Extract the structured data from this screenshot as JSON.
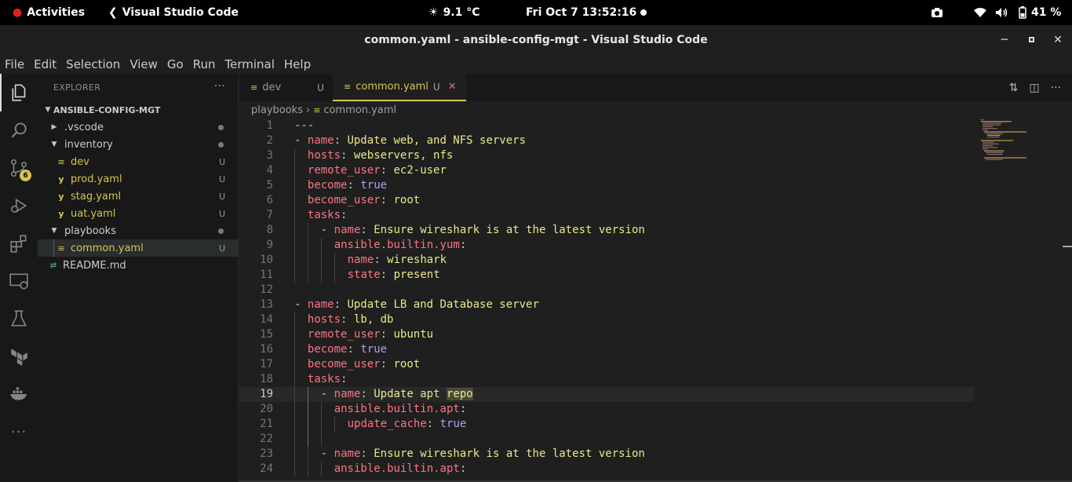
{
  "topbar": {
    "activities": "Activities",
    "app_name": "Visual Studio Code",
    "weather": "9.1 °C",
    "datetime": "Fri Oct 7  13:52:16",
    "battery": "41 %"
  },
  "window": {
    "title": "common.yaml - ansible-config-mgt - Visual Studio Code"
  },
  "menu": [
    "File",
    "Edit",
    "Selection",
    "View",
    "Go",
    "Run",
    "Terminal",
    "Help"
  ],
  "activity": {
    "scm_badge": "6"
  },
  "explorer": {
    "header": "EXPLORER",
    "root": "ANSIBLE-CONFIG-MGT",
    "items": [
      {
        "label": ".vscode",
        "deco": ""
      },
      {
        "label": "inventory",
        "deco": ""
      },
      {
        "label": "dev",
        "deco": "U"
      },
      {
        "label": "prod.yaml",
        "deco": "U"
      },
      {
        "label": "stag.yaml",
        "deco": "U"
      },
      {
        "label": "uat.yaml",
        "deco": "U"
      },
      {
        "label": "playbooks",
        "deco": ""
      },
      {
        "label": "common.yaml",
        "deco": "U"
      },
      {
        "label": "README.md",
        "deco": ""
      }
    ]
  },
  "tabs": [
    {
      "label": "dev",
      "modified": "U"
    },
    {
      "label": "common.yaml",
      "modified": "U"
    }
  ],
  "breadcrumb": {
    "folder": "playbooks",
    "file": "common.yaml"
  },
  "editor": {
    "current_line": 19,
    "lines": [
      [
        "1",
        "---"
      ],
      [
        "2",
        "- name: Update web, and NFS servers"
      ],
      [
        "3",
        "hosts: webservers, nfs"
      ],
      [
        "4",
        "remote_user: ec2-user"
      ],
      [
        "5",
        "become: true"
      ],
      [
        "6",
        "become_user: root"
      ],
      [
        "7",
        "tasks:"
      ],
      [
        "8",
        "- name: Ensure wireshark is at the latest version"
      ],
      [
        "9",
        "ansible.builtin.yum:"
      ],
      [
        "10",
        "name: wireshark"
      ],
      [
        "11",
        "state: present"
      ],
      [
        "12",
        ""
      ],
      [
        "13",
        "- name: Update LB and Database server"
      ],
      [
        "14",
        "hosts: lb, db"
      ],
      [
        "15",
        "remote_user: ubuntu"
      ],
      [
        "16",
        "become: true"
      ],
      [
        "17",
        "become_user: root"
      ],
      [
        "18",
        "tasks:"
      ],
      [
        "19",
        "- name: Update apt repo"
      ],
      [
        "20",
        "ansible.builtin.apt:"
      ],
      [
        "21",
        "update_cache: true"
      ],
      [
        "22",
        ""
      ],
      [
        "23",
        "- name: Ensure wireshark is at the latest version"
      ],
      [
        "24",
        "ansible.builtin.apt:"
      ]
    ]
  },
  "colors": {
    "accent": "#d6c64e",
    "key": "#f97583",
    "string": "#e9e88a",
    "bool": "#b39df3"
  }
}
